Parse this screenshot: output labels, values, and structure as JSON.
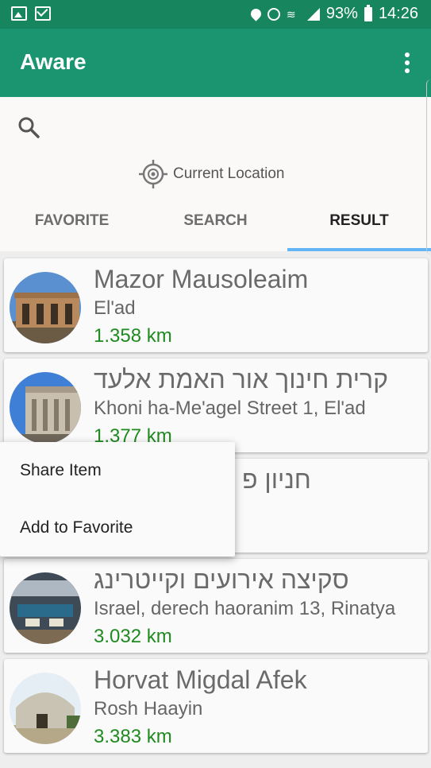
{
  "status_bar": {
    "battery": "93%",
    "time": "14:26"
  },
  "app_bar": {
    "title": "Aware"
  },
  "location": {
    "label": "Current Location"
  },
  "tabs": [
    {
      "label": "FAVORITE",
      "active": false
    },
    {
      "label": "SEARCH",
      "active": false
    },
    {
      "label": "RESULT",
      "active": true
    }
  ],
  "results": [
    {
      "title": "Mazor Mausoleaim",
      "address": "El'ad",
      "distance": "1.358 km"
    },
    {
      "title": "קרית חינוך אור האמת אלעד",
      "address": "Khoni ha-Me'agel Street 1, El'ad",
      "distance": "1.377 km"
    },
    {
      "title": "חניון פ",
      "address": "",
      "distance": ""
    },
    {
      "title": "סקיצה אירועים וקייטרינג",
      "address": "Israel, derech haoranim 13, Rinatya",
      "distance": "3.032 km"
    },
    {
      "title": "Horvat Migdal Afek",
      "address": "Rosh Haayin",
      "distance": "3.383 km"
    }
  ],
  "context_menu": {
    "items": [
      {
        "label": "Share Item"
      },
      {
        "label": "Add to Favorite"
      }
    ]
  },
  "colors": {
    "status_bar": "#17865f",
    "app_bar": "#1b9470",
    "tab_indicator": "#64b5f6",
    "distance_text": "#1f8a1f"
  },
  "icons": {
    "search": "search-icon",
    "location": "gps-target-icon",
    "overflow": "more-vert-icon"
  }
}
